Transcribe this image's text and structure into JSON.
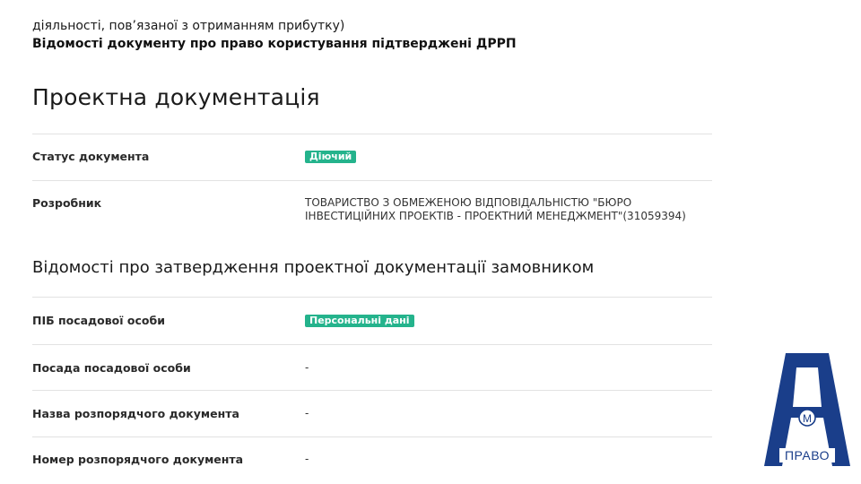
{
  "header": {
    "line1": "діяльності, пов’язаної з отриманням прибутку)",
    "line2_bold": "Відомості документу про право користування підтверджені ДРРП"
  },
  "project_docs": {
    "title": "Проектна документація",
    "rows": [
      {
        "label": "Статус документа",
        "badge": "Діючий"
      },
      {
        "label": "Розробник",
        "value_line1": "ТОВАРИСТВО З ОБМЕЖЕНОЮ ВІДПОВІДАЛЬНІСТЮ \"БЮРО",
        "value_line2": "ІНВЕСТИЦІЙНИХ ПРОЕКТІВ - ПРОЕКТНИЙ МЕНЕДЖМЕНТ\"(31059394)"
      }
    ]
  },
  "approval": {
    "title": "Відомості про затвердження проектної документації замовником",
    "rows": [
      {
        "label": "ПІБ посадової особи",
        "badge": "Персональні дані"
      },
      {
        "label": "Посада посадової особи",
        "value": "-"
      },
      {
        "label": "Назва розпорядчого документа",
        "value": "-"
      },
      {
        "label": "Номер розпорядчого документа",
        "value": "-"
      }
    ]
  },
  "logo": {
    "letter": "М",
    "text": "ПРАВО",
    "color": "#1a3e8a"
  },
  "colors": {
    "badge_green": "#24b38c",
    "divider": "#e2e2e2"
  }
}
